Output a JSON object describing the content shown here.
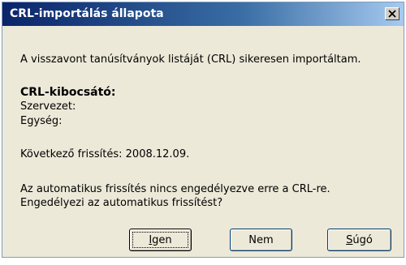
{
  "dialog": {
    "title": "CRL-importálás állapota",
    "close_glyph": "×"
  },
  "body": {
    "message": "A visszavont tanúsítványok listáját (CRL) sikeresen importáltam.",
    "issuer_heading": "CRL-kibocsátó:",
    "organization_label": "Szervezet:",
    "unit_label": "Egység:",
    "next_update": "Következő frissítés: 2008.12.09.",
    "question_line1": "Az automatikus frissítés nincs engedélyezve erre a CRL-re.",
    "question_line2": "Engedélyezi az automatikus frissítést?"
  },
  "buttons": {
    "yes_accesskey": "I",
    "yes_rest": "gen",
    "no": "Nem",
    "help_accesskey": "S",
    "help_rest": "úgó"
  },
  "icons": {
    "close": "close-icon"
  }
}
